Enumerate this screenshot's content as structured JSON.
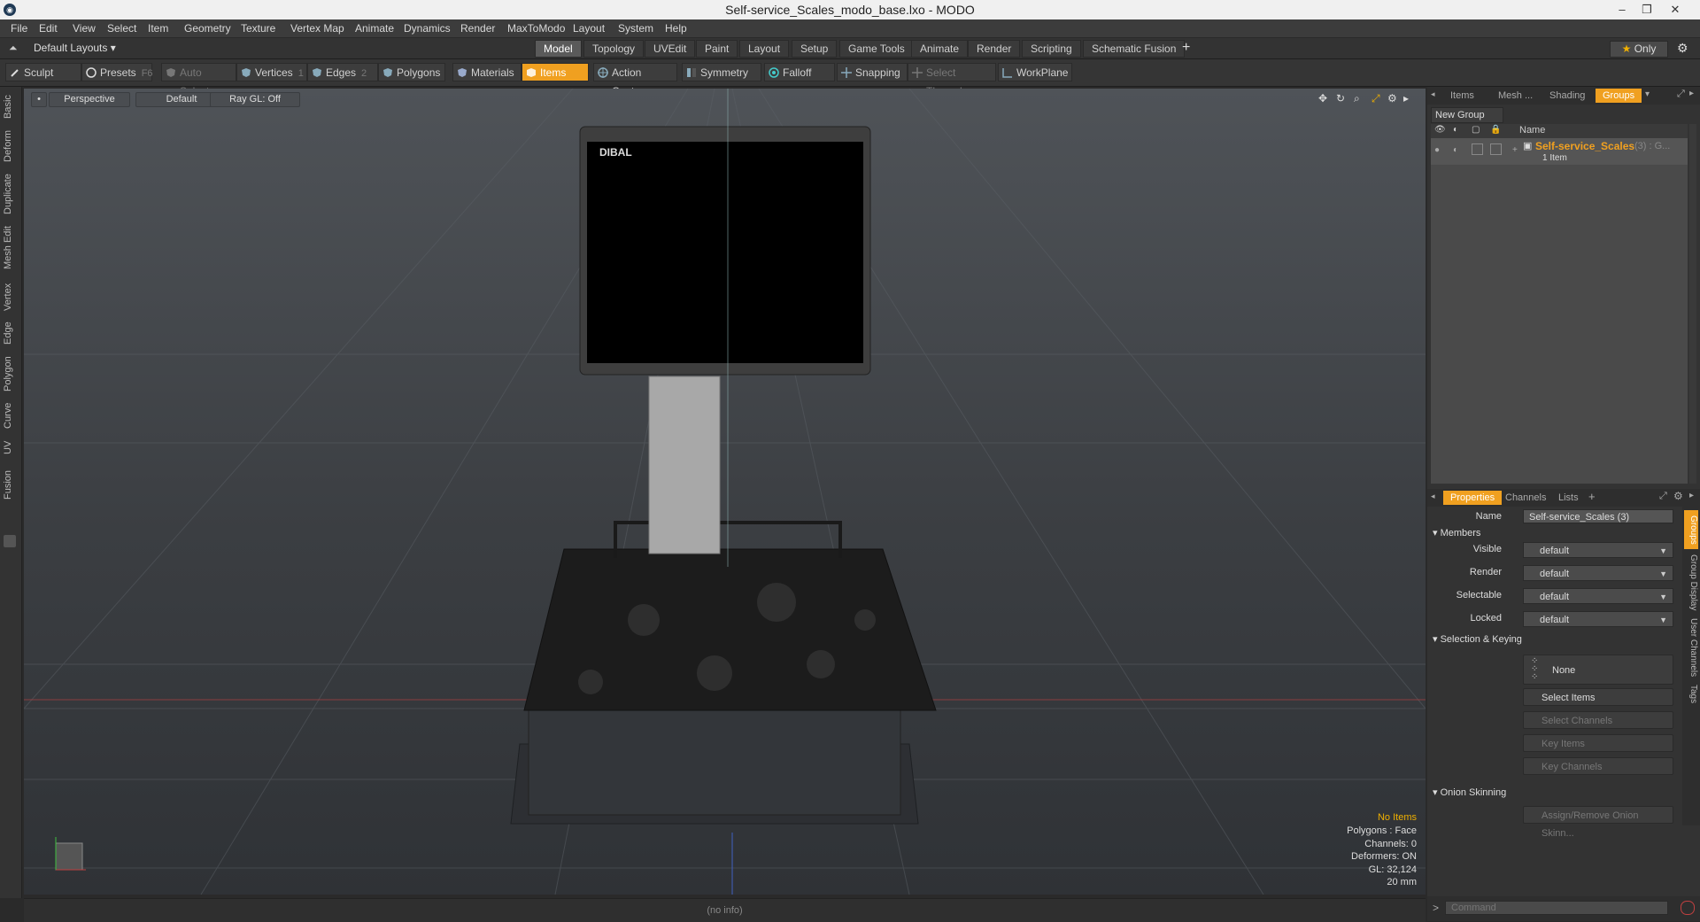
{
  "window": {
    "title": "Self-service_Scales_modo_base.lxo - MODO"
  },
  "menu": [
    "File",
    "Edit",
    "View",
    "Select",
    "Item",
    "Geometry",
    "Texture",
    "Vertex Map",
    "Animate",
    "Dynamics",
    "Render",
    "MaxToModo",
    "Layout",
    "System",
    "Help"
  ],
  "layout_selector": "Default Layouts ▾",
  "layout_tabs": [
    "Model",
    "Topology",
    "UVEdit",
    "Paint",
    "Layout",
    "Setup",
    "Game Tools",
    "Animate",
    "Render",
    "Scripting",
    "Schematic Fusion"
  ],
  "only_label": "Only",
  "tools": {
    "sculpt": "Sculpt",
    "presets": "Presets",
    "presets_key": "F6",
    "auto_select": "Auto Select",
    "vertices": "Vertices",
    "vertices_count": "1",
    "edges": "Edges",
    "edges_count": "2",
    "polygons": "Polygons",
    "materials": "Materials",
    "items": "Items",
    "action_center": "Action Center",
    "symmetry": "Symmetry",
    "falloff": "Falloff",
    "snapping": "Snapping",
    "select_through": "Select Through",
    "workplane": "WorkPlane"
  },
  "left_tabs": [
    "Basic",
    "Deform",
    "Duplicate",
    "Mesh Edit",
    "Vertex",
    "Edge",
    "Polygon",
    "Curve",
    "UV",
    "Fusion"
  ],
  "viewport": {
    "view": "Perspective",
    "shading": "Default",
    "raygl": "Ray GL: Off",
    "brand": "DIBAL",
    "info": {
      "items": "No Items",
      "polygons": "Polygons : Face",
      "channels": "Channels: 0",
      "deformers": "Deformers: ON",
      "gl": "GL: 32,124",
      "unit": "20 mm"
    }
  },
  "status": "(no info)",
  "groups_panel": {
    "tabs": [
      "Items",
      "Mesh ...",
      "Shading",
      "Groups"
    ],
    "new_group": "New Group",
    "col_name": "Name",
    "group_name": "Self-service_Scales",
    "group_count": "(3) : G...",
    "group_sub": "1 Item"
  },
  "properties": {
    "tabs": [
      "Properties",
      "Channels",
      "Lists"
    ],
    "name_label": "Name",
    "name_value": "Self-service_Scales (3)",
    "members_section": "Members",
    "rows": [
      {
        "label": "Visible",
        "value": "default"
      },
      {
        "label": "Render",
        "value": "default"
      },
      {
        "label": "Selectable",
        "value": "default"
      },
      {
        "label": "Locked",
        "value": "default"
      }
    ],
    "selection_section": "Selection & Keying",
    "none_label": "None",
    "select_items": "Select Items",
    "select_channels": "Select Channels",
    "key_items": "Key Items",
    "key_channels": "Key Channels",
    "onion_section": "Onion Skinning",
    "onion_button": "Assign/Remove Onion Skinn...",
    "side_tabs": [
      "Groups",
      "Group Display",
      "User Channels",
      "Tags"
    ]
  },
  "command_placeholder": "Command"
}
